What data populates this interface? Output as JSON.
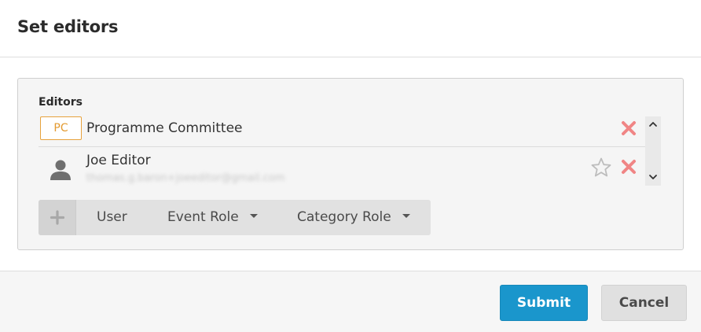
{
  "dialog": {
    "title": "Set editors"
  },
  "editors": {
    "label": "Editors",
    "items": [
      {
        "type": "role",
        "badge": "PC",
        "name": "Programme Committee",
        "remove_icon": "close-icon"
      },
      {
        "type": "user",
        "name": "Joe Editor",
        "email": "thomas.g.baron+joeeditor@gmail.com",
        "avatar_icon": "person-icon",
        "favorite_icon": "star-outline-icon",
        "remove_icon": "close-icon"
      }
    ]
  },
  "toolbar": {
    "add_icon": "plus-icon",
    "user_label": "User",
    "event_role_label": "Event Role",
    "category_role_label": "Category Role"
  },
  "footer": {
    "submit_label": "Submit",
    "cancel_label": "Cancel"
  },
  "colors": {
    "primary": "#1a96cc",
    "badge": "#e39a2f",
    "remove": "#f08585"
  }
}
